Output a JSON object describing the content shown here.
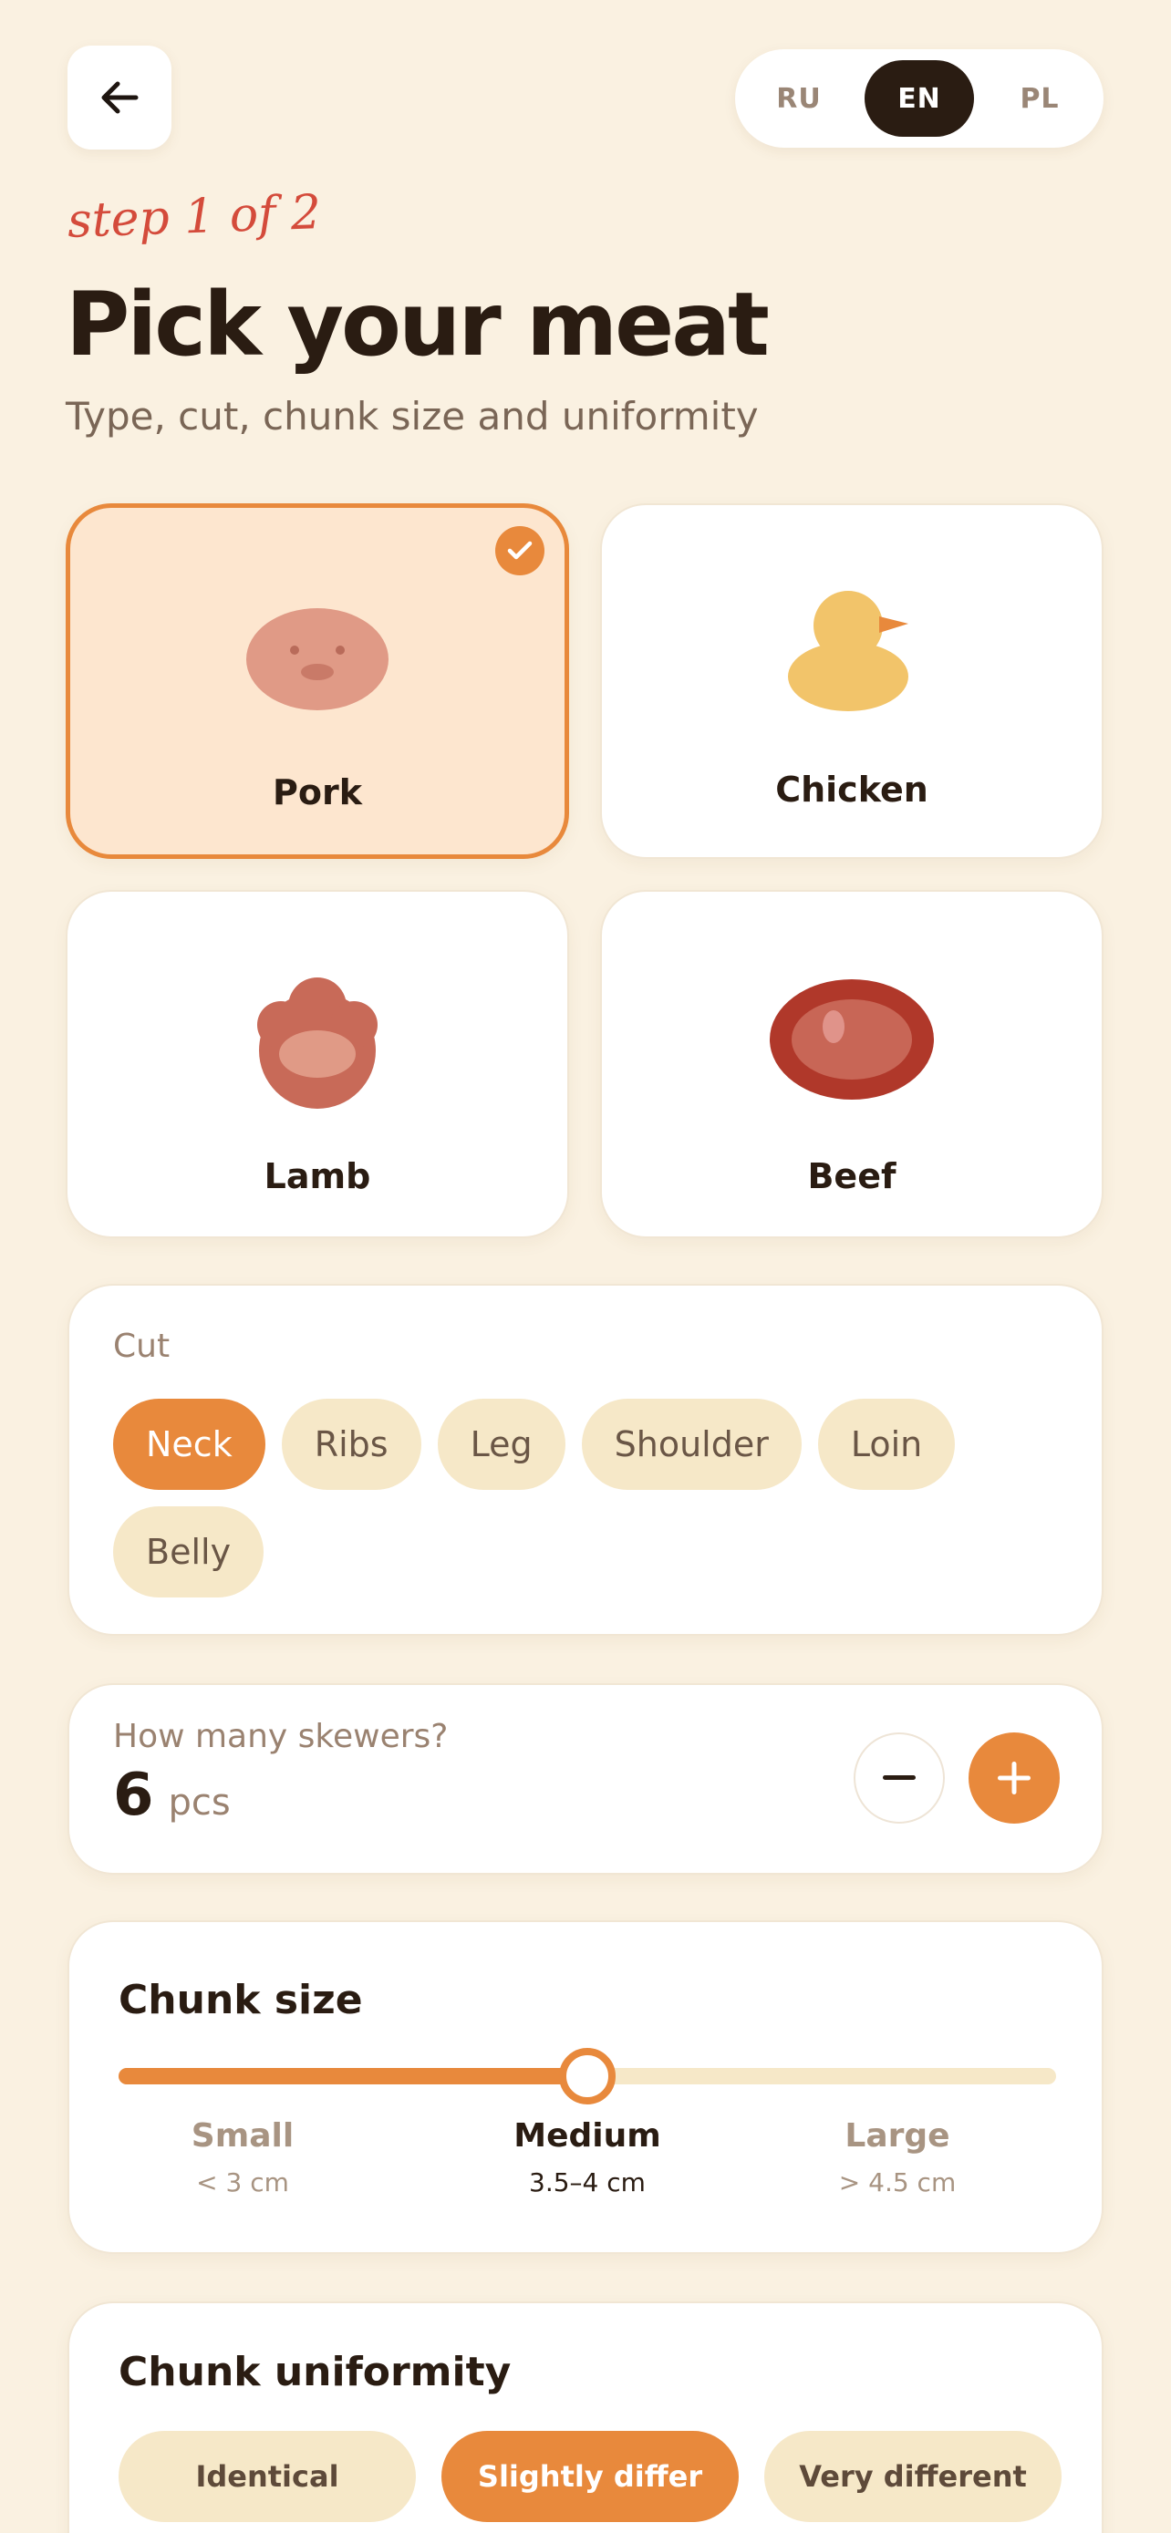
{
  "header": {
    "languages": [
      "RU",
      "EN",
      "PL"
    ],
    "active_language": "EN",
    "step_label": "step 1 of 2",
    "title": "Pick your meat",
    "subtitle": "Type, cut, chunk size and uniformity"
  },
  "meats": [
    {
      "label": "Pork",
      "icon": "pig-icon",
      "selected": true
    },
    {
      "label": "Chicken",
      "icon": "chick-icon",
      "selected": false
    },
    {
      "label": "Lamb",
      "icon": "lamb-icon",
      "selected": false
    },
    {
      "label": "Beef",
      "icon": "steak-icon",
      "selected": false
    }
  ],
  "cut": {
    "label": "Cut",
    "options": [
      "Neck",
      "Ribs",
      "Leg",
      "Shoulder",
      "Loin",
      "Belly"
    ],
    "selected": "Neck"
  },
  "skewers": {
    "question": "How many skewers?",
    "count": "6",
    "unit": "pcs"
  },
  "chunk_size": {
    "title": "Chunk size",
    "level": 0.5,
    "options": [
      {
        "name": "Small",
        "range": "< 3 cm"
      },
      {
        "name": "Medium",
        "range": "3.5–4 cm"
      },
      {
        "name": "Large",
        "range": "> 4.5 cm"
      }
    ],
    "selected": "Medium"
  },
  "uniformity": {
    "title": "Chunk uniformity",
    "options": [
      "Identical",
      "Slightly differ",
      "Very different"
    ],
    "selected": "Slightly differ"
  },
  "colors": {
    "background": "#FAF1E1",
    "accent": "#E8893C",
    "dark": "#2A1C12",
    "step_red": "#D44B3B"
  }
}
